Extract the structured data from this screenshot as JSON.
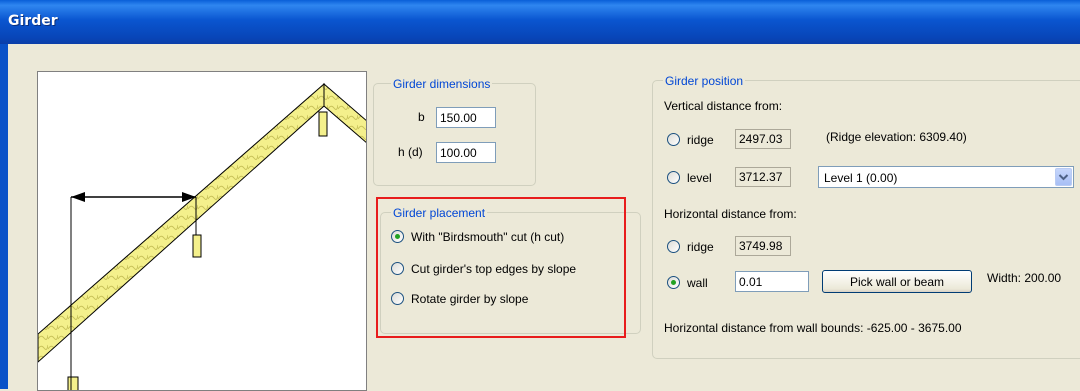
{
  "window": {
    "title": "Girder"
  },
  "dimensions": {
    "legend": "Girder dimensions",
    "b_label": "b",
    "b_value": "150.00",
    "h_label": "h (d)",
    "h_value": "100.00"
  },
  "placement": {
    "legend": "Girder placement",
    "options": [
      {
        "label": "With \"Birdsmouth\" cut (h cut)",
        "selected": true
      },
      {
        "label": "Cut girder's top edges by slope",
        "selected": false
      },
      {
        "label": "Rotate girder by slope",
        "selected": false
      }
    ]
  },
  "position": {
    "legend": "Girder position",
    "vertical_heading": "Vertical distance from:",
    "ridge_label": "ridge",
    "ridge_value": "2497.03",
    "ridge_elevation": "(Ridge elevation: 6309.40)",
    "level_label": "level",
    "level_value": "3712.37",
    "level_select_value": "Level 1 (0.00)",
    "horizontal_heading": "Horizontal distance from:",
    "h_ridge_label": "ridge",
    "h_ridge_value": "3749.98",
    "wall_label": "wall",
    "wall_value": "0.01",
    "pick_button": "Pick wall or beam",
    "width_text": "Width: 200.00",
    "bounds_text": "Horizontal distance from wall bounds: -625.00 - 3675.00",
    "vertical_selected": "none",
    "horizontal_selected": "wall"
  },
  "colors": {
    "accent_blue": "#0046d5",
    "highlight_red": "#e81c1c",
    "timber_fill": "#f4f08c",
    "radio_dot": "#21a121"
  }
}
